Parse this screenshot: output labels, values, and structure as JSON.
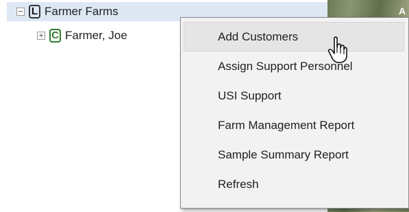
{
  "tree": {
    "nodes": [
      {
        "toggle": "−",
        "badge": "L",
        "label": "Farmer Farms"
      },
      {
        "toggle": "+",
        "badge": "C",
        "label": "Farmer, Joe"
      }
    ]
  },
  "map": {
    "fragment_text": "A"
  },
  "context_menu": {
    "items": [
      "Add Customers",
      "Assign Support Personnel",
      "USI Support",
      "Farm Management Report",
      "Sample Summary Report",
      "Refresh"
    ]
  }
}
